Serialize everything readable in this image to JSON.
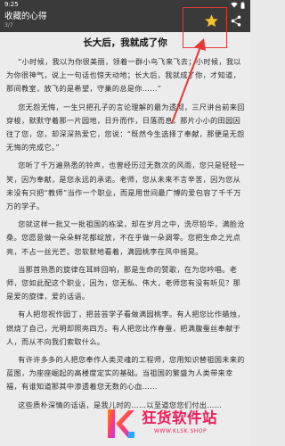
{
  "status_bar": {
    "time": "9:25"
  },
  "app_bar": {
    "title": "收藏的心得",
    "subtitle": "3/7",
    "star_icon": "star-icon",
    "share_icon": "share-icon",
    "star_color": "#f2c230"
  },
  "annotation": {
    "highlight_color": "#e53935"
  },
  "article": {
    "title": "长大后，我就成了你",
    "paragraphs": [
      "“小时候，我以为你很美丽，领着一群小鸟飞来飞去；小时候，我以为你很神气，说上一句话也惊天动地；长大后，我就成了你，才知道，那间教室，放飞的是希望，守巢的总是你……”",
      "您无怨无悔，一生只把孔子的言论理解的最为透彻，三尺讲台前来回穿梭，默默守着那一片园地，日升而作，日落而息，那片小小的田园因往了您，您，却深深热爱它，您说：“既然今生选择了奉献，那便是无怨无悔的完成它。”",
      "您听了千万遍熟悉的铃声，也曾经历过无数次的风雨，您只是轻轻一笑，因为奉献，是您永远的承诺。老师，您从未来不言辛苦，因为您从未没有只把“教师”当作一个职业，而是用世间最广博的爱包容了千千万万的学子。",
      "您就这样一批又一批祖国的栋梁，却在岁月之中，洗尽铅华，满脸沧桑。您愿意做一朵朵鲜花都绽放，不在乎做一朵调零。您把生命之光点亮，不占一丝光芒。您软默地看着，满园桃李在风中摇晃。",
      "当那首熟悉的旋律在耳畔回响，那是生命的赞歌，在为您吟唱。老师，您如此配这个职业，因为，您无私、伟大，老师您有没有听见？那是爱的旋律，爱的话语。",
      "有人把您祝作园丁，把芸芸学子看做满园桃李。有人把您比作蜡烛，燃烧了自己，光明却照亮四方。有人把您比作春蚕，把满腹蚕丝奉献于人，而从不向我们索取什么。",
      "有许许多多的人把您奉作人类灵魂的工程师，您用知识替祖国未来的蓝图，为座座崛起的高楼度定实的基础。当祖国的繁盛为人类带来幸福，有谁知道那其中渗透着您无数的心血……",
      "这些质朴深情的话语，是我儿时的……以至道您您们付出……"
    ]
  },
  "watermark": {
    "main_text": "狂货软件站",
    "url": "WWW.KLSK.SHOP",
    "brand_color": "#f01f5a"
  }
}
